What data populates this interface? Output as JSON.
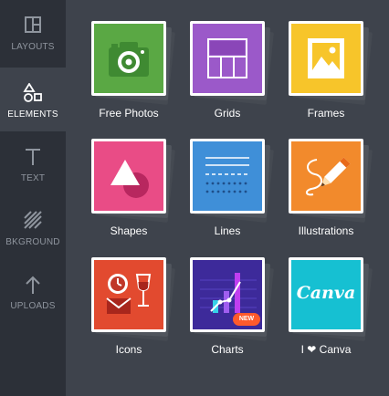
{
  "sidebar": {
    "items": [
      {
        "label": "LAYOUTS",
        "icon": "layouts-icon",
        "active": false
      },
      {
        "label": "ELEMENTS",
        "icon": "elements-icon",
        "active": true
      },
      {
        "label": "TEXT",
        "icon": "text-icon",
        "active": false
      },
      {
        "label": "BKGROUND",
        "icon": "background-icon",
        "active": false
      },
      {
        "label": "UPLOADS",
        "icon": "upload-icon",
        "active": false
      }
    ]
  },
  "elements": {
    "tiles": [
      {
        "label": "Free Photos",
        "color": "#5aa844",
        "icon": "camera-icon"
      },
      {
        "label": "Grids",
        "color": "#9b59c9",
        "icon": "grid-icon"
      },
      {
        "label": "Frames",
        "color": "#f7c52a",
        "icon": "frame-icon"
      },
      {
        "label": "Shapes",
        "color": "#e94c86",
        "icon": "shapes-icon"
      },
      {
        "label": "Lines",
        "color": "#3f8fd8",
        "icon": "lines-icon"
      },
      {
        "label": "Illustrations",
        "color": "#f28a2c",
        "icon": "pencil-icon"
      },
      {
        "label": "Icons",
        "color": "#e24a2f",
        "icon": "icons-icon"
      },
      {
        "label": "Charts",
        "color": "#3d2a9a",
        "icon": "chart-icon",
        "badge": "NEW"
      },
      {
        "label": "I ❤ Canva",
        "color": "#16c0d2",
        "icon": "canva-logo-icon",
        "logo_text": "Canva"
      }
    ]
  }
}
